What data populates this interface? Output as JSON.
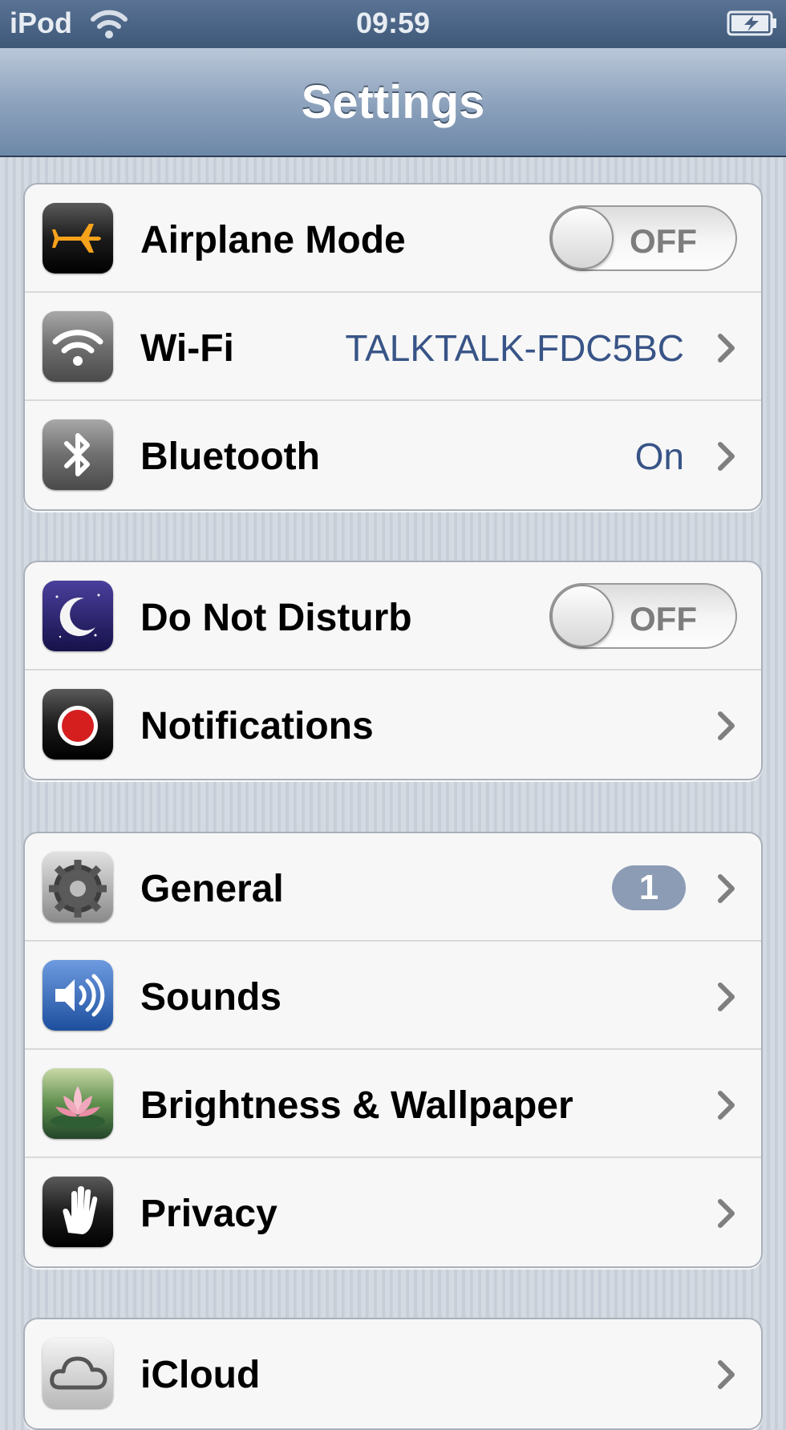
{
  "status_bar": {
    "carrier": "iPod",
    "time": "09:59"
  },
  "nav_bar": {
    "title": "Settings"
  },
  "groups": [
    [
      {
        "label": "Airplane Mode",
        "icon": "airplane-icon",
        "control": "toggle",
        "toggle_text": "OFF"
      },
      {
        "label": "Wi-Fi",
        "icon": "wifi-icon",
        "value": "TALKTALK-FDC5BC"
      },
      {
        "label": "Bluetooth",
        "icon": "bluetooth-icon",
        "value": "On"
      }
    ],
    [
      {
        "label": "Do Not Disturb",
        "icon": "moon-icon",
        "control": "toggle",
        "toggle_text": "OFF"
      },
      {
        "label": "Notifications",
        "icon": "notifications-icon"
      }
    ],
    [
      {
        "label": "General",
        "icon": "gear-icon",
        "badge": "1"
      },
      {
        "label": "Sounds",
        "icon": "speaker-icon"
      },
      {
        "label": "Brightness & Wallpaper",
        "icon": "lotus-icon"
      },
      {
        "label": "Privacy",
        "icon": "hand-icon"
      }
    ],
    [
      {
        "label": "iCloud",
        "icon": "cloud-icon"
      }
    ]
  ],
  "colors": {
    "value_text": "#385487",
    "badge": "#8c9cb5",
    "nav_bar": "#6d88a8"
  }
}
